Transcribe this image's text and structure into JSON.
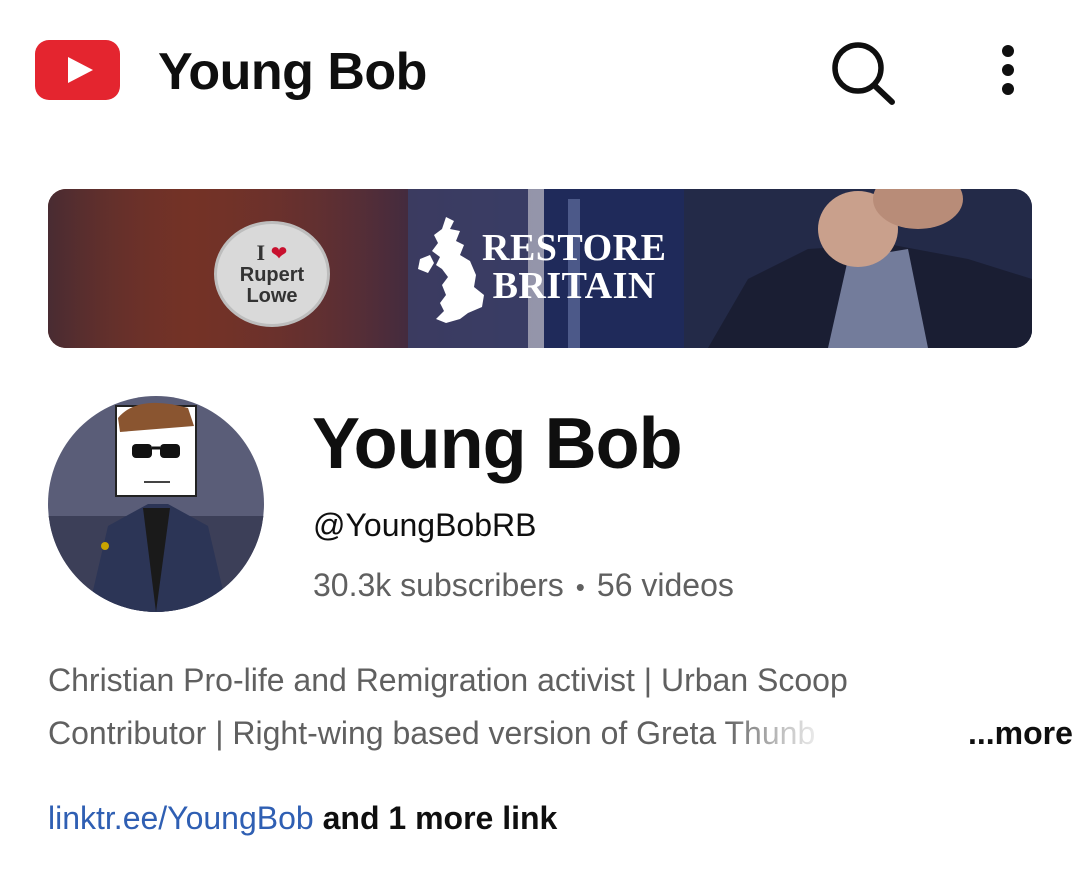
{
  "app": {
    "logo_icon": "youtube-logo-icon",
    "title": "Young Bob",
    "search_icon": "search-icon",
    "menu_icon": "more-vertical-icon",
    "brand_color": "#ff0000"
  },
  "banner": {
    "badge_line1": "I",
    "badge_line2": "Rupert",
    "badge_line3": "Lowe",
    "heading_line1": "RESTORE",
    "heading_line2": "BRITAIN"
  },
  "channel": {
    "avatar_icon": "channel-avatar",
    "name": "Young Bob",
    "handle": "@YoungBobRB",
    "subscribers": "30.3k subscribers",
    "separator": "•",
    "videos": "56 videos"
  },
  "description": {
    "line1": "Christian Pro-life and Remigration activist | Urban Scoop",
    "line2_start": "Contributor | Right-wing based version of Greta ",
    "line2_fade": "Thunb",
    "more_label": "...more"
  },
  "links": {
    "primary_link": "linktr.ee/YoungBob",
    "more_links": "and 1 more link",
    "link_color": "#2f5fb3"
  }
}
